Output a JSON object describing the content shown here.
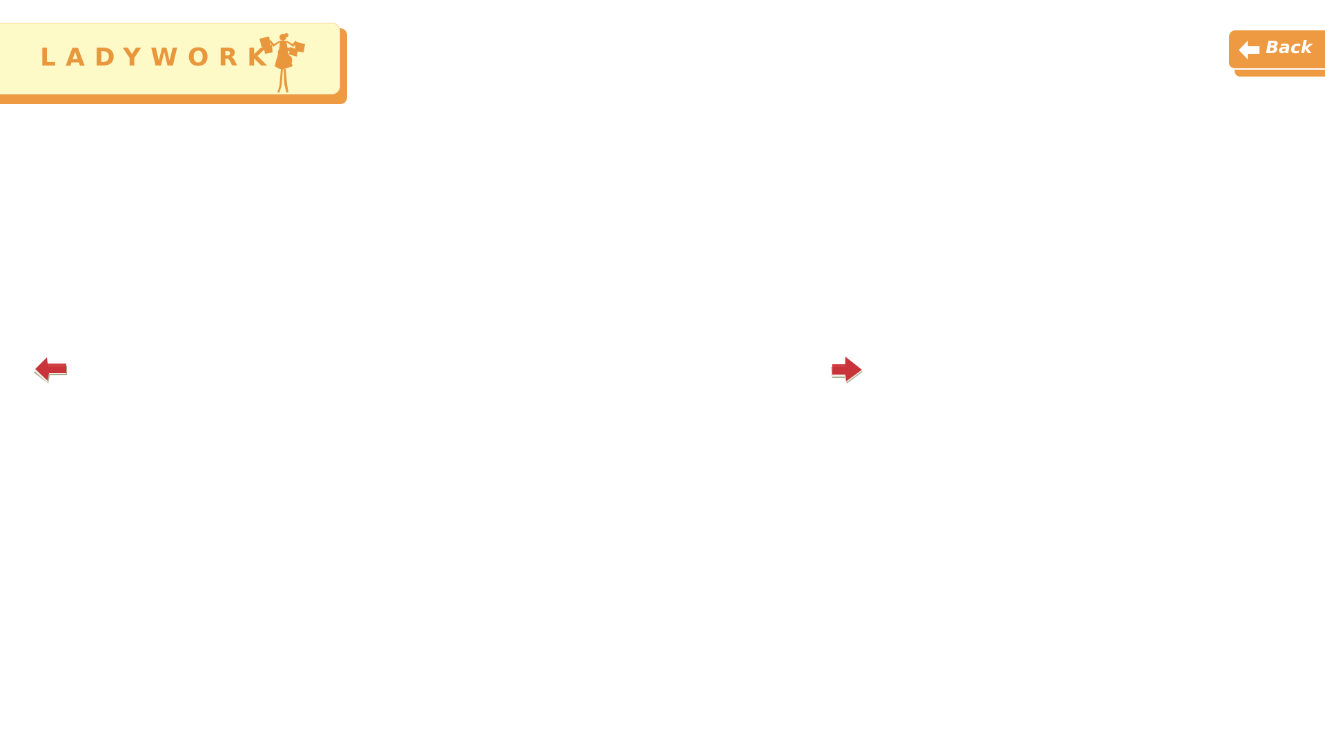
{
  "logo": {
    "text": "LADYWORKS",
    "figure_icon": "lady-silhouette-icon"
  },
  "back_button": {
    "label": "Back",
    "icon": "left-arrow-icon"
  },
  "navigation": {
    "prev_icon": "left-arrow-icon",
    "next_icon": "right-arrow-icon"
  },
  "colors": {
    "orange_accent": "#ee9a42",
    "logo_cream": "#fefac8",
    "logo_text": "#e9973d",
    "arrow_red": "#c9343a",
    "arrow_shadow": "#8a8f6a",
    "background": "#ffffff"
  }
}
